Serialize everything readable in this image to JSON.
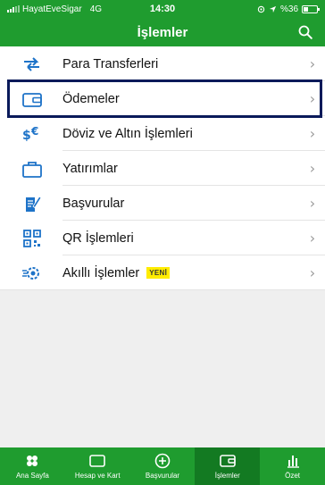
{
  "status_bar": {
    "carrier": "HayatEveSigar",
    "network": "4G",
    "time": "14:30",
    "battery": "%36"
  },
  "header": {
    "title": "İşlemler",
    "search_icon": "search-icon"
  },
  "menu": {
    "items": [
      {
        "label": "Para Transferleri",
        "icon": "transfer-arrows-icon",
        "badge": ""
      },
      {
        "label": "Ödemeler",
        "icon": "wallet-icon",
        "badge": ""
      },
      {
        "label": "Döviz ve Altın İşlemleri",
        "icon": "currency-icon",
        "badge": ""
      },
      {
        "label": "Yatırımlar",
        "icon": "briefcase-icon",
        "badge": ""
      },
      {
        "label": "Başvurular",
        "icon": "application-form-icon",
        "badge": ""
      },
      {
        "label": "QR İşlemleri",
        "icon": "qr-code-icon",
        "badge": ""
      },
      {
        "label": "Akıllı İşlemler",
        "icon": "smart-gear-icon",
        "badge": "YENİ"
      }
    ]
  },
  "tab_bar": {
    "tabs": [
      {
        "label": "Ana Sayfa",
        "icon": "home-clover-icon",
        "active": false
      },
      {
        "label": "Hesap ve Kart",
        "icon": "card-icon",
        "active": false
      },
      {
        "label": "Başvurular",
        "icon": "plus-circle-icon",
        "active": false
      },
      {
        "label": "İşlemler",
        "icon": "wallet-icon",
        "active": true
      },
      {
        "label": "Özet",
        "icon": "bar-chart-icon",
        "active": false
      }
    ]
  },
  "colors": {
    "brand_green": "#1f9c2f",
    "active_tab": "#137a22",
    "icon_blue": "#1e73c8",
    "highlight_border": "#0a1a5a",
    "badge_yellow": "#ffec00"
  }
}
